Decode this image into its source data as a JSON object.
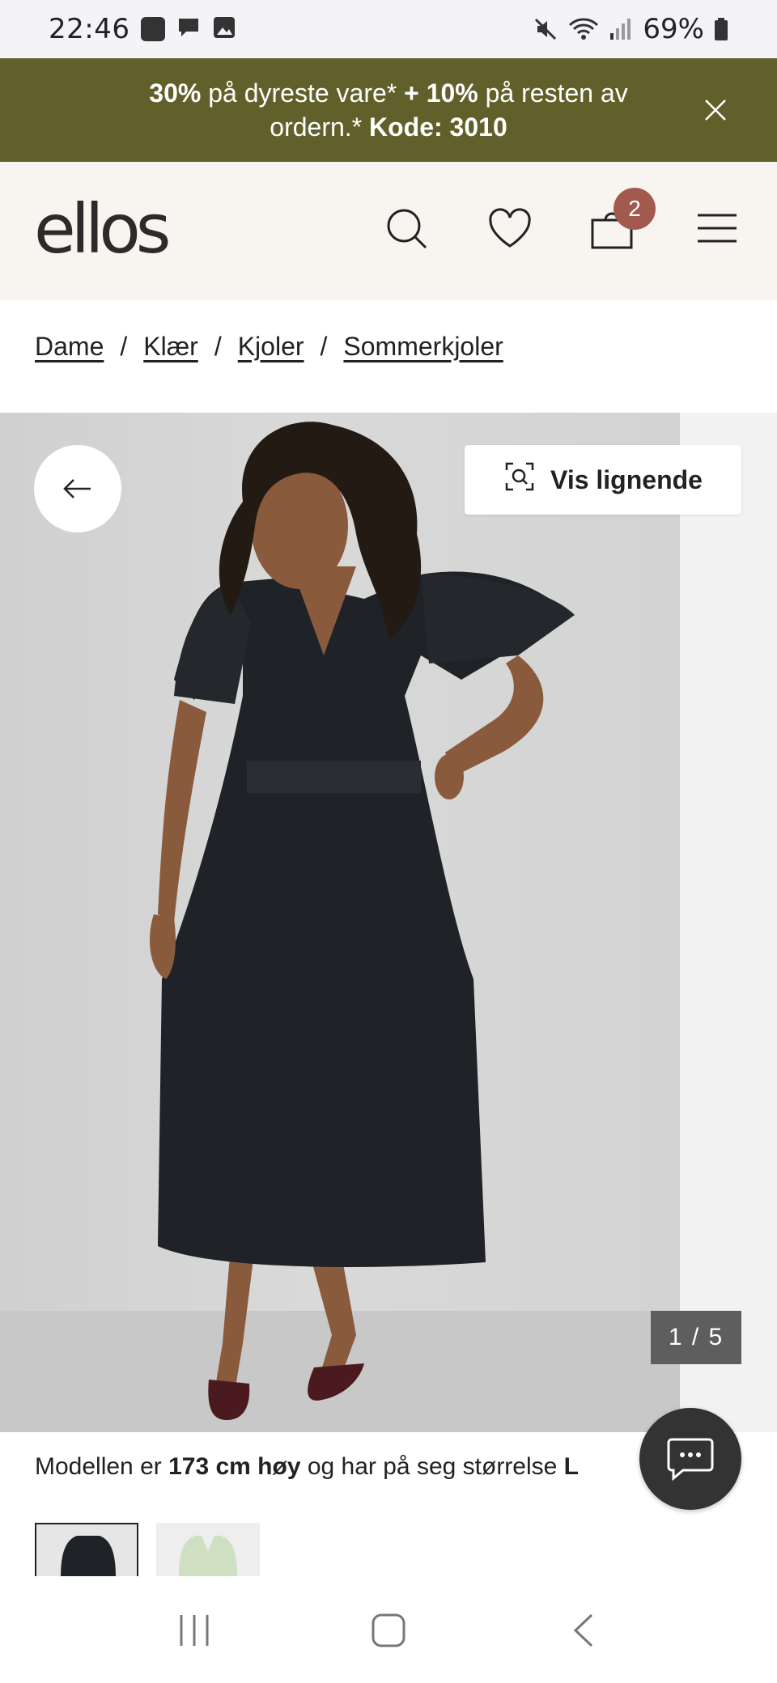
{
  "status_bar": {
    "time": "22:46",
    "battery": "69%"
  },
  "promo": {
    "part1_bold": "30%",
    "part2": " på dyreste vare* ",
    "part3_bold": "+ 10%",
    "part4": " på resten av ordern.* ",
    "part5_bold": "Kode: 3010"
  },
  "header": {
    "logo": "ellos",
    "cart_count": "2"
  },
  "breadcrumb": [
    "Dame",
    "Klær",
    "Kjoler",
    "Sommerkjoler"
  ],
  "breadcrumb_separator": "/",
  "product_image": {
    "similar_label": "Vis lignende",
    "counter": "1 / 5",
    "dress_color": "#1f2226",
    "shoe_color": "#4a1a1e"
  },
  "model_info": {
    "text1": "Modellen er ",
    "height_bold": "173 cm høy",
    "text2": " og har på seg størrelse ",
    "size_bold": "L"
  },
  "colors": {
    "promo_bg": "#62602a",
    "header_bg": "#f8f5f1",
    "badge_bg": "#a35a4e"
  }
}
